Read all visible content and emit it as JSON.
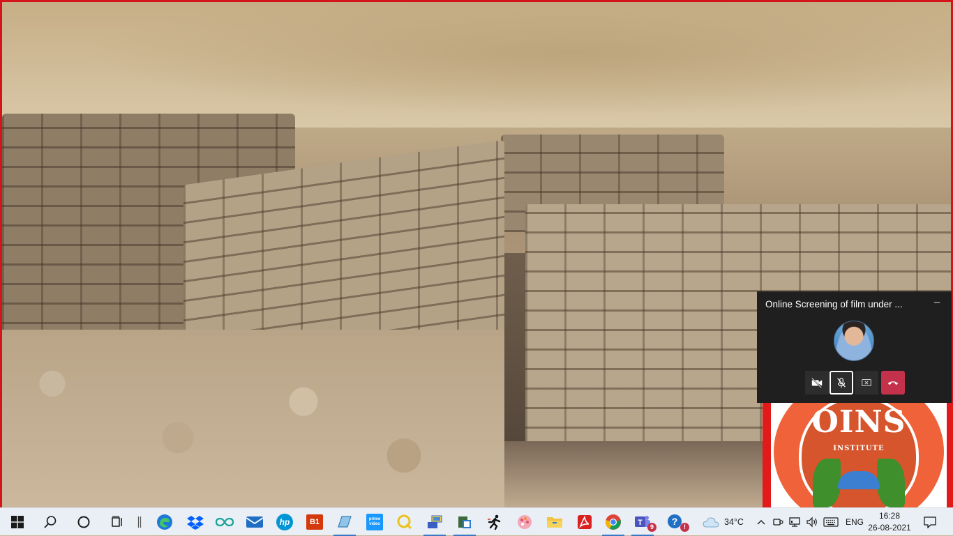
{
  "call": {
    "title": "Online Screening of film under ...",
    "minimize_label": "–",
    "controls": [
      "camera-off-icon",
      "mic-off-icon",
      "stop-share-icon",
      "hang-up-icon"
    ]
  },
  "logo_tile": {
    "text": "OINS",
    "subtext": "INSTITUTE"
  },
  "taskbar": {
    "apps": [
      {
        "name": "start",
        "icon": "windows-icon"
      },
      {
        "name": "search",
        "icon": "search-icon"
      },
      {
        "name": "cortana",
        "icon": "cortana-icon"
      },
      {
        "name": "task-view",
        "icon": "task-view-icon"
      },
      {
        "name": "edge",
        "icon": "edge-icon"
      },
      {
        "name": "dropbox",
        "icon": "dropbox-icon"
      },
      {
        "name": "infinity",
        "icon": "infinity-icon"
      },
      {
        "name": "mail",
        "icon": "mail-icon"
      },
      {
        "name": "hp",
        "icon": "hp-icon",
        "label": "hp"
      },
      {
        "name": "b1",
        "icon": "b1-icon",
        "label": "B1"
      },
      {
        "name": "notes",
        "icon": "notes-icon"
      },
      {
        "name": "prime-video",
        "icon": "prime-video-icon",
        "label": "prime video"
      },
      {
        "name": "quicklook",
        "icon": "q-icon"
      },
      {
        "name": "network-tool",
        "icon": "network-icon"
      },
      {
        "name": "dictionary",
        "icon": "dictionary-icon"
      },
      {
        "name": "runner",
        "icon": "runner-icon"
      },
      {
        "name": "paint",
        "icon": "paint-icon"
      },
      {
        "name": "file-explorer",
        "icon": "folder-icon"
      },
      {
        "name": "acrobat",
        "icon": "acrobat-icon"
      },
      {
        "name": "chrome",
        "icon": "chrome-icon"
      },
      {
        "name": "teams",
        "icon": "teams-icon",
        "badge": "9"
      },
      {
        "name": "help",
        "icon": "help-icon",
        "badge": "!"
      }
    ],
    "weather": "34°C",
    "language": "ENG",
    "time": "16:28",
    "date": "26-08-2021"
  },
  "colors": {
    "accent_red": "#c4314b",
    "frame_red": "#d3141b",
    "taskbar_bg": "#eaeff5",
    "call_bg": "#1f1f1f"
  }
}
